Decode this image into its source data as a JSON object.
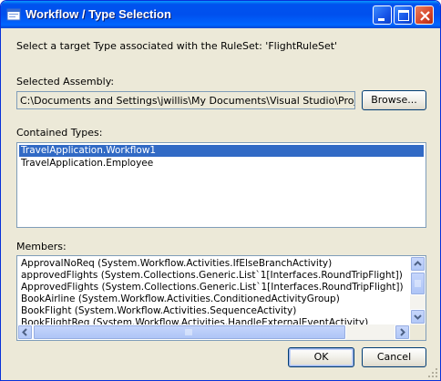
{
  "window": {
    "title": "Workflow / Type Selection"
  },
  "instructions": "Select a target Type associated with the RuleSet: 'FlightRuleSet'",
  "assembly": {
    "label": "Selected Assembly:",
    "path": "C:\\Documents and Settings\\jwillis\\My Documents\\Visual Studio\\Projects\\Tra",
    "browse_label": "Browse..."
  },
  "types": {
    "label": "Contained Types:",
    "items": [
      {
        "text": "TravelApplication.Workflow1",
        "selected": true
      },
      {
        "text": "TravelApplication.Employee",
        "selected": false
      }
    ]
  },
  "members": {
    "label": "Members:",
    "items": [
      "ApprovalNoReq    (System.Workflow.Activities.IfElseBranchActivity)",
      "approvedFlights    (System.Collections.Generic.List`1[Interfaces.RoundTripFlight])",
      "ApprovedFlights    (System.Collections.Generic.List`1[Interfaces.RoundTripFlight])",
      "BookAirline    (System.Workflow.Activities.ConditionedActivityGroup)",
      "BookFlight    (System.Workflow.Activities.SequenceActivity)",
      "BookFlightReq    (System.Workflow.Activities.HandleExternalEventActivity)"
    ]
  },
  "buttons": {
    "ok": "OK",
    "cancel": "Cancel"
  },
  "colors": {
    "titlebar": "#0054e3",
    "selection": "#316ac5",
    "dialog_bg": "#ece9d8",
    "field_border": "#7f9db9"
  }
}
